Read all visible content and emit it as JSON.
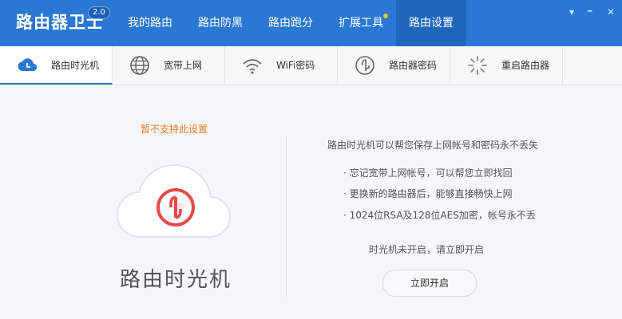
{
  "app": {
    "title": "路由器卫士",
    "version": "2.0"
  },
  "nav": [
    {
      "label": "我的路由"
    },
    {
      "label": "路由防黑"
    },
    {
      "label": "路由跑分"
    },
    {
      "label": "扩展工具"
    },
    {
      "label": "路由设置"
    }
  ],
  "window_controls": {
    "menu": "▾",
    "minimize": "━",
    "close": "✕"
  },
  "tabs": [
    {
      "label": "路由时光机",
      "icon": "cloud-clock-icon"
    },
    {
      "label": "宽带上网",
      "icon": "globe-icon"
    },
    {
      "label": "WiFi密码",
      "icon": "wifi-icon"
    },
    {
      "label": "路由器密码",
      "icon": "lock-icon"
    },
    {
      "label": "重启路由器",
      "icon": "loading-icon"
    }
  ],
  "main": {
    "warning": "暂不支持此设置",
    "title": "路由时光机",
    "desc": "路由时光机可以帮您保存上网帐号和密码永不丢失",
    "points": [
      "· 忘记宽带上网帐号，可以帮您立即找回",
      "· 更换新的路由器后，能够直接畅快上网",
      "· 1024位RSA及128位AES加密，帐号永不丢"
    ],
    "status": "时光机未开启，请立即开启",
    "button": "立即开启"
  },
  "colors": {
    "primary": "#2a78d4",
    "warning": "#f07b20",
    "icon_red": "#e34b4b"
  }
}
